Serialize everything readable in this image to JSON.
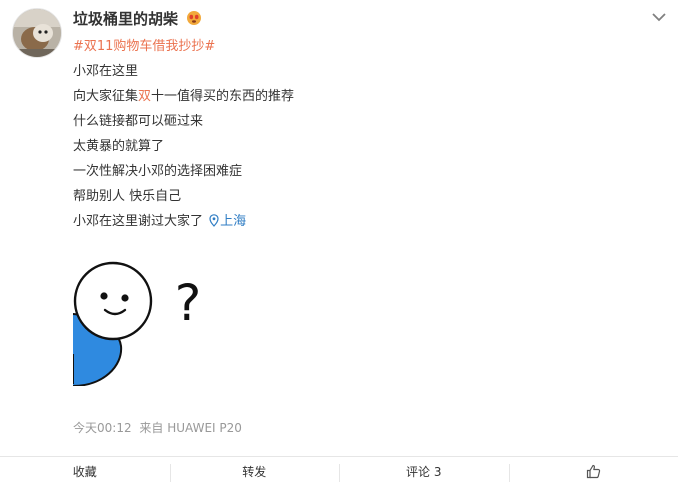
{
  "post": {
    "username": "垃圾桶里的胡柴",
    "emoji_icon": "red-face-emoji-icon",
    "hashtag": "#双11购物车借我抄抄#",
    "lines": {
      "l1": "小邓在这里",
      "l2_pre": "向大家征集",
      "l2_hl": "双",
      "l2_post": "十一值得买的东西的推荐",
      "l3": "什么链接都可以砸过来",
      "l4": "太黄暴的就算了",
      "l5": "一次性解决小邓的选择困难症",
      "l6": "帮助别人 快乐自己",
      "l7": "小邓在这里谢过大家了"
    },
    "location": "上海",
    "time": "今天00:12",
    "source": "来自 HUAWEI P20",
    "image_text": "?"
  },
  "actions": {
    "favorite": "收藏",
    "repost": "转发",
    "comment": "评论 3",
    "like_icon": "thumbs-up-icon"
  },
  "colors": {
    "hashtag": "#eb7350",
    "link": "#2f7dc4",
    "meta": "#999999",
    "bubble_blue": "#2f8ae0"
  }
}
